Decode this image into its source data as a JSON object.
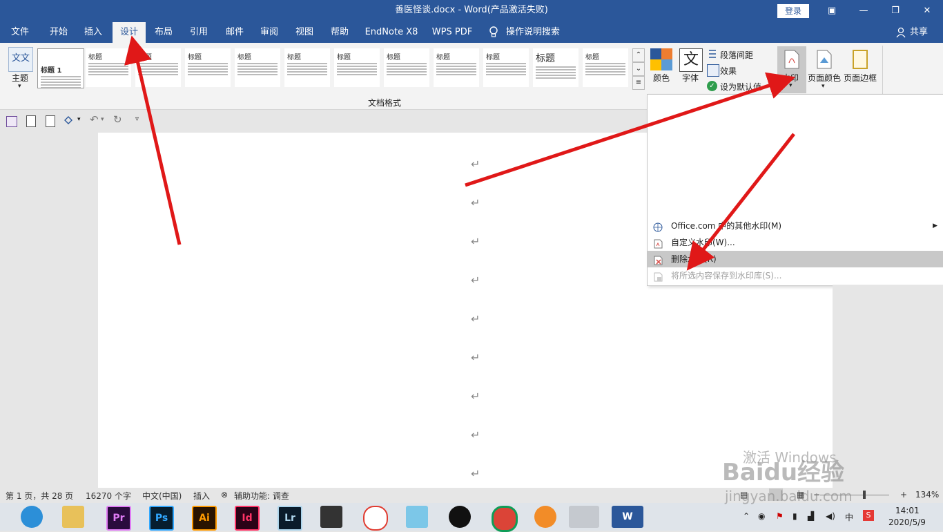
{
  "window": {
    "title": "善医怪谈.docx  -  Word(产品激活失败)",
    "login": "登录",
    "controls": [
      "▣",
      "—",
      "❐",
      "✕"
    ]
  },
  "menu": {
    "tabs": [
      "文件",
      "开始",
      "插入",
      "设计",
      "布局",
      "引用",
      "邮件",
      "审阅",
      "视图",
      "帮助",
      "EndNote X8",
      "WPS PDF"
    ],
    "active_tab": "设计",
    "search": "操作说明搜索",
    "share": "共享"
  },
  "ribbon": {
    "theme_label": "主题",
    "gallery_title": "文档格式",
    "gallery_heads": [
      "标题",
      "标题",
      "标题",
      "标题",
      "标题",
      "标题",
      "标题",
      "标题",
      "标题",
      "标题",
      "标题",
      "标题"
    ],
    "first_item_text": "标题 1",
    "colors": "颜色",
    "fonts": "字体",
    "para_spacing": "段落间距",
    "effects": "效果",
    "set_default": "设为默认值",
    "watermark": "水印",
    "page_color": "页面颜色",
    "page_border": "页面边框"
  },
  "watermark_menu": {
    "items": [
      {
        "label": "Office.com 中的其他水印(M)",
        "state": "normal"
      },
      {
        "label": "自定义水印(W)...",
        "state": "normal"
      },
      {
        "label": "删除水印(R)",
        "state": "hover"
      },
      {
        "label": "将所选内容保存到水印库(S)...",
        "state": "disabled"
      }
    ]
  },
  "document": {
    "para_mark": "↵"
  },
  "status": {
    "page": "第 1 页，共 28 页",
    "words": "16270 个字",
    "lang": "中文(中国)",
    "mode": "插入",
    "accessibility": "辅助功能: 调查",
    "zoom": "134%"
  },
  "overlay": {
    "activate": "激活 Windows",
    "baidu": "Baidu经验",
    "url": "jingyan.baidu.com"
  },
  "taskbar": {
    "apps": [
      "Pr",
      "Ps",
      "Ai",
      "Id",
      "Lr",
      "W"
    ],
    "time": "14:01",
    "date": "2020/5/9",
    "ime": "中"
  }
}
